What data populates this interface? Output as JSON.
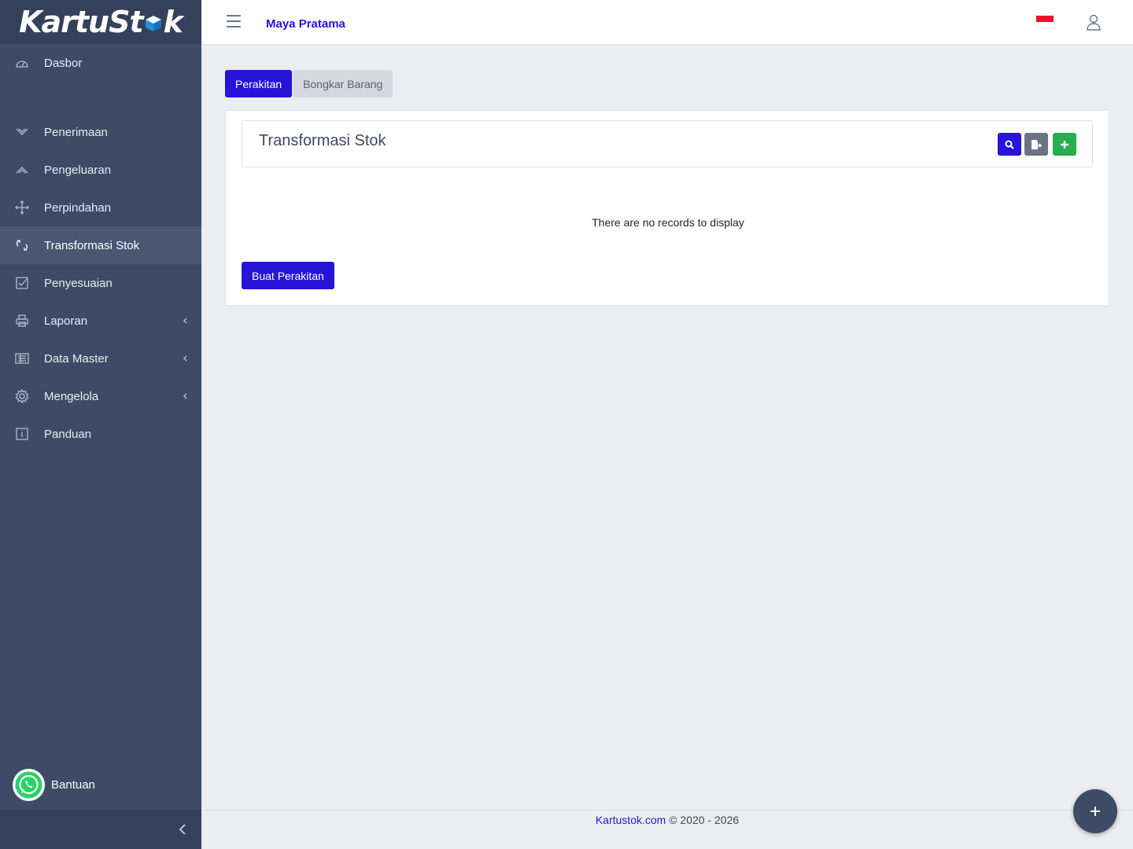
{
  "brand": {
    "logo_text_1": "KartuSt",
    "logo_text_2": "k"
  },
  "sidebar": {
    "items": [
      {
        "label": "Dasbor",
        "icon": "dashboard-icon"
      },
      {
        "label": "Penerimaan",
        "icon": "inbound-icon"
      },
      {
        "label": "Pengeluaran",
        "icon": "outbound-icon"
      },
      {
        "label": "Perpindahan",
        "icon": "move-icon"
      },
      {
        "label": "Transformasi Stok",
        "icon": "transform-icon",
        "active": true
      },
      {
        "label": "Penyesuaian",
        "icon": "checkbox-icon"
      },
      {
        "label": "Laporan",
        "icon": "printer-icon",
        "submenu": true
      },
      {
        "label": "Data Master",
        "icon": "list-icon",
        "submenu": true
      },
      {
        "label": "Mengelola",
        "icon": "gear-icon",
        "submenu": true
      },
      {
        "label": "Panduan",
        "icon": "info-icon"
      }
    ],
    "help_label": "Bantuan"
  },
  "topbar": {
    "company": "Maya Pratama",
    "language_flag": "indonesia-flag-icon"
  },
  "tabs": [
    {
      "label": "Perakitan",
      "active": true
    },
    {
      "label": "Bongkar Barang",
      "active": false
    }
  ],
  "card": {
    "title": "Transformasi Stok",
    "empty_text": "There are no records to display",
    "primary_button": "Buat Perakitan"
  },
  "footer": {
    "link": "Kartustok.com",
    "copyright": " © 2020 - 2026"
  },
  "colors": {
    "primary": "#2614d8",
    "sidebar": "#3e4b66",
    "success": "#27ae4e",
    "secondary": "#6c7484"
  }
}
